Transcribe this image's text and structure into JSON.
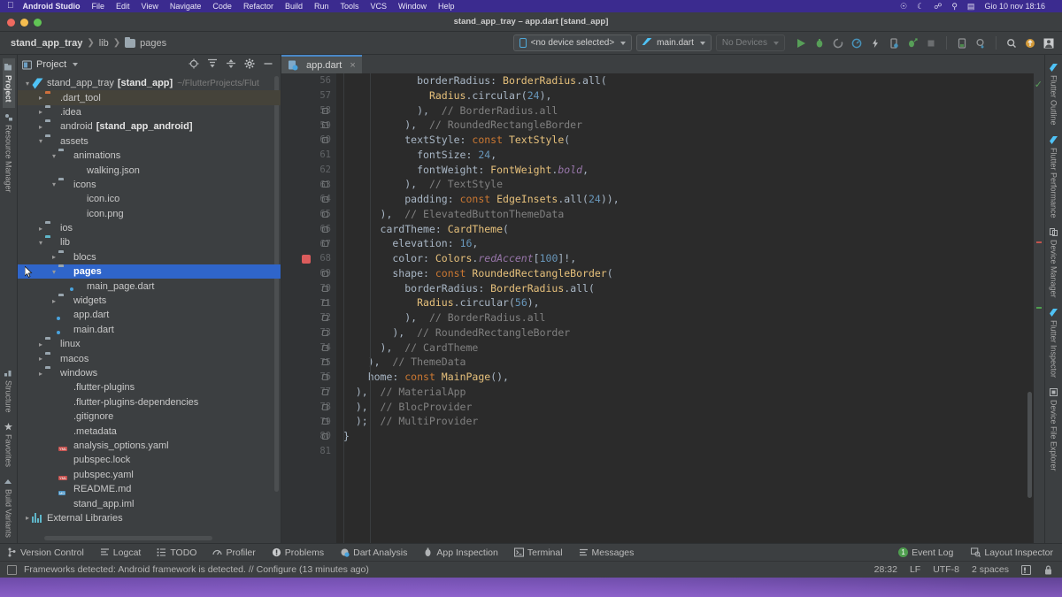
{
  "menubar": {
    "apple": "apple-logo",
    "items": [
      "Android Studio",
      "File",
      "Edit",
      "View",
      "Navigate",
      "Code",
      "Refactor",
      "Build",
      "Run",
      "Tools",
      "VCS",
      "Window",
      "Help"
    ],
    "status_icons": [
      "wifi-icon",
      "moon-icon",
      "bluetooth-icon",
      "search-icon",
      "control-center-icon"
    ],
    "clock": "Gio 10 nov 18:16"
  },
  "window": {
    "title": "stand_app_tray – app.dart [stand_app]"
  },
  "navbar": {
    "breadcrumbs": [
      "stand_app_tray",
      "lib",
      "pages"
    ],
    "device_selector": "<no device selected>",
    "run_config": "main.dart",
    "devices": "No Devices",
    "toolbar_icons": [
      "run-icon",
      "debug-icon",
      "run-with-coverage-icon",
      "profile-icon",
      "flash-hot-reload-icon",
      "device-icon",
      "attach-debugger-icon",
      "stop-icon",
      "device-manager-icon",
      "sdk-manager-icon",
      "search-everywhere-icon",
      "update-icon",
      "avatar-icon"
    ]
  },
  "left_rail": {
    "items": [
      "Project",
      "Resource Manager",
      "Structure",
      "Favorites",
      "Build Variants"
    ],
    "active": "Project"
  },
  "right_rail": {
    "items": [
      "Flutter Outline",
      "Flutter Performance",
      "Device Manager",
      "Flutter Inspector",
      "Device File Explorer"
    ]
  },
  "project_panel": {
    "title": "Project",
    "tools": [
      "locate-icon",
      "expand-all-icon",
      "collapse-all-icon",
      "settings-gear-icon",
      "minimize-icon"
    ],
    "tree": [
      {
        "label": "stand_app_tray",
        "bold_suffix": "[stand_app]",
        "path": "~/FlutterProjects/Flut",
        "indent": 0,
        "arrow": "v",
        "icon": "flutter-icon"
      },
      {
        "label": ".dart_tool",
        "indent": 1,
        "arrow": ">",
        "icon": "folder-orange-icon",
        "tint": true
      },
      {
        "label": ".idea",
        "indent": 1,
        "arrow": ">",
        "icon": "folder-idea-icon"
      },
      {
        "label": "android",
        "bold_suffix": "[stand_app_android]",
        "indent": 1,
        "arrow": ">",
        "icon": "folder-module-icon"
      },
      {
        "label": "assets",
        "indent": 1,
        "arrow": "v",
        "icon": "folder-icon"
      },
      {
        "label": "animations",
        "indent": 2,
        "arrow": "v",
        "icon": "folder-icon"
      },
      {
        "label": "walking.json",
        "indent": 3,
        "arrow": "",
        "icon": "json-file-icon"
      },
      {
        "label": "icons",
        "indent": 2,
        "arrow": "v",
        "icon": "folder-icon"
      },
      {
        "label": "icon.ico",
        "indent": 3,
        "arrow": "",
        "icon": "image-file-icon"
      },
      {
        "label": "icon.png",
        "indent": 3,
        "arrow": "",
        "icon": "image-file-icon"
      },
      {
        "label": "ios",
        "indent": 1,
        "arrow": ">",
        "icon": "folder-module-icon"
      },
      {
        "label": "lib",
        "indent": 1,
        "arrow": "v",
        "icon": "folder-source-icon"
      },
      {
        "label": "blocs",
        "indent": 2,
        "arrow": ">",
        "icon": "folder-icon"
      },
      {
        "label": "pages",
        "indent": 2,
        "arrow": "v",
        "icon": "folder-icon",
        "selected": true
      },
      {
        "label": "main_page.dart",
        "indent": 3,
        "arrow": "",
        "icon": "dart-file-icon"
      },
      {
        "label": "widgets",
        "indent": 2,
        "arrow": ">",
        "icon": "folder-icon"
      },
      {
        "label": "app.dart",
        "indent": 2,
        "arrow": "",
        "icon": "dart-file-icon"
      },
      {
        "label": "main.dart",
        "indent": 2,
        "arrow": "",
        "icon": "dart-file-icon"
      },
      {
        "label": "linux",
        "indent": 1,
        "arrow": ">",
        "icon": "folder-icon"
      },
      {
        "label": "macos",
        "indent": 1,
        "arrow": ">",
        "icon": "folder-icon"
      },
      {
        "label": "windows",
        "indent": 1,
        "arrow": ">",
        "icon": "folder-icon"
      },
      {
        "label": ".flutter-plugins",
        "indent": 2,
        "arrow": "",
        "icon": "file-icon"
      },
      {
        "label": ".flutter-plugins-dependencies",
        "indent": 2,
        "arrow": "",
        "icon": "file-icon"
      },
      {
        "label": ".gitignore",
        "indent": 2,
        "arrow": "",
        "icon": "gitignore-file-icon"
      },
      {
        "label": ".metadata",
        "indent": 2,
        "arrow": "",
        "icon": "file-icon"
      },
      {
        "label": "analysis_options.yaml",
        "indent": 2,
        "arrow": "",
        "icon": "yaml-file-icon"
      },
      {
        "label": "pubspec.lock",
        "indent": 2,
        "arrow": "",
        "icon": "file-icon"
      },
      {
        "label": "pubspec.yaml",
        "indent": 2,
        "arrow": "",
        "icon": "yaml-file-icon"
      },
      {
        "label": "README.md",
        "indent": 2,
        "arrow": "",
        "icon": "markdown-file-icon"
      },
      {
        "label": "stand_app.iml",
        "indent": 2,
        "arrow": "",
        "icon": "iml-file-icon"
      },
      {
        "label": "External Libraries",
        "indent": 0,
        "arrow": ">",
        "icon": "libraries-icon"
      }
    ]
  },
  "editor": {
    "tab": {
      "label": "app.dart",
      "close": "×",
      "icon": "dart-file-icon"
    },
    "first_line_number": 56,
    "breakpoint_line": 68,
    "lines": [
      {
        "n": 56,
        "tokens": [
          {
            "t": "            borderRadius: ",
            "c": "id"
          },
          {
            "t": "BorderRadius",
            "c": "typ"
          },
          {
            "t": ".all(",
            "c": "id"
          }
        ]
      },
      {
        "n": 57,
        "tokens": [
          {
            "t": "              ",
            "c": "id"
          },
          {
            "t": "Radius",
            "c": "typ"
          },
          {
            "t": ".circular(",
            "c": "id"
          },
          {
            "t": "24",
            "c": "num"
          },
          {
            "t": "),",
            "c": "id"
          }
        ]
      },
      {
        "n": 58,
        "tokens": [
          {
            "t": "            ),  ",
            "c": "id"
          },
          {
            "t": "// BorderRadius.all",
            "c": "cm"
          }
        ]
      },
      {
        "n": 59,
        "tokens": [
          {
            "t": "          ),  ",
            "c": "id"
          },
          {
            "t": "// RoundedRectangleBorder",
            "c": "cm"
          }
        ]
      },
      {
        "n": 60,
        "tokens": [
          {
            "t": "          textStyle: ",
            "c": "id"
          },
          {
            "t": "const ",
            "c": "kw"
          },
          {
            "t": "TextStyle",
            "c": "typ"
          },
          {
            "t": "(",
            "c": "id"
          }
        ]
      },
      {
        "n": 61,
        "tokens": [
          {
            "t": "            fontSize: ",
            "c": "id"
          },
          {
            "t": "24",
            "c": "num"
          },
          {
            "t": ",",
            "c": "id"
          }
        ]
      },
      {
        "n": 62,
        "tokens": [
          {
            "t": "            fontWeight: ",
            "c": "id"
          },
          {
            "t": "FontWeight",
            "c": "typ"
          },
          {
            "t": ".",
            "c": "id"
          },
          {
            "t": "bold",
            "c": "fld"
          },
          {
            "t": ",",
            "c": "id"
          }
        ]
      },
      {
        "n": 63,
        "tokens": [
          {
            "t": "          ),  ",
            "c": "id"
          },
          {
            "t": "// TextStyle",
            "c": "cm"
          }
        ]
      },
      {
        "n": 64,
        "tokens": [
          {
            "t": "          padding: ",
            "c": "id"
          },
          {
            "t": "const ",
            "c": "kw"
          },
          {
            "t": "EdgeInsets",
            "c": "typ"
          },
          {
            "t": ".all(",
            "c": "id"
          },
          {
            "t": "24",
            "c": "num"
          },
          {
            "t": ")),",
            "c": "id"
          }
        ]
      },
      {
        "n": 65,
        "tokens": [
          {
            "t": "      ),  ",
            "c": "id"
          },
          {
            "t": "// ElevatedButtonThemeData",
            "c": "cm"
          }
        ]
      },
      {
        "n": 66,
        "tokens": [
          {
            "t": "      cardTheme: ",
            "c": "id"
          },
          {
            "t": "CardTheme",
            "c": "typ"
          },
          {
            "t": "(",
            "c": "id"
          }
        ]
      },
      {
        "n": 67,
        "tokens": [
          {
            "t": "        elevation: ",
            "c": "id"
          },
          {
            "t": "16",
            "c": "num"
          },
          {
            "t": ",",
            "c": "id"
          }
        ]
      },
      {
        "n": 68,
        "tokens": [
          {
            "t": "        color: ",
            "c": "id"
          },
          {
            "t": "Colors",
            "c": "typ"
          },
          {
            "t": ".",
            "c": "id"
          },
          {
            "t": "redAccent",
            "c": "fld"
          },
          {
            "t": "[",
            "c": "id"
          },
          {
            "t": "100",
            "c": "num"
          },
          {
            "t": "]!,",
            "c": "id"
          }
        ]
      },
      {
        "n": 69,
        "tokens": [
          {
            "t": "        shape: ",
            "c": "id"
          },
          {
            "t": "const ",
            "c": "kw"
          },
          {
            "t": "RoundedRectangleBorder",
            "c": "typ"
          },
          {
            "t": "(",
            "c": "id"
          }
        ]
      },
      {
        "n": 70,
        "tokens": [
          {
            "t": "          borderRadius: ",
            "c": "id"
          },
          {
            "t": "BorderRadius",
            "c": "typ"
          },
          {
            "t": ".all(",
            "c": "id"
          }
        ]
      },
      {
        "n": 71,
        "tokens": [
          {
            "t": "            ",
            "c": "id"
          },
          {
            "t": "Radius",
            "c": "typ"
          },
          {
            "t": ".circular(",
            "c": "id"
          },
          {
            "t": "56",
            "c": "num"
          },
          {
            "t": "),",
            "c": "id"
          }
        ]
      },
      {
        "n": 72,
        "tokens": [
          {
            "t": "          ),  ",
            "c": "id"
          },
          {
            "t": "// BorderRadius.all",
            "c": "cm"
          }
        ]
      },
      {
        "n": 73,
        "tokens": [
          {
            "t": "        ),  ",
            "c": "id"
          },
          {
            "t": "// RoundedRectangleBorder",
            "c": "cm"
          }
        ]
      },
      {
        "n": 74,
        "tokens": [
          {
            "t": "      ),  ",
            "c": "id"
          },
          {
            "t": "// CardTheme",
            "c": "cm"
          }
        ]
      },
      {
        "n": 75,
        "tokens": [
          {
            "t": "    ),  ",
            "c": "id"
          },
          {
            "t": "// ThemeData",
            "c": "cm"
          }
        ]
      },
      {
        "n": 76,
        "tokens": [
          {
            "t": "    home: ",
            "c": "id"
          },
          {
            "t": "const ",
            "c": "kw"
          },
          {
            "t": "MainPage",
            "c": "typ"
          },
          {
            "t": "(),",
            "c": "id"
          }
        ]
      },
      {
        "n": 77,
        "tokens": [
          {
            "t": "  ),  ",
            "c": "id"
          },
          {
            "t": "// MaterialApp",
            "c": "cm"
          }
        ]
      },
      {
        "n": 78,
        "tokens": [
          {
            "t": "  ),  ",
            "c": "id"
          },
          {
            "t": "// BlocProvider",
            "c": "cm"
          }
        ]
      },
      {
        "n": 79,
        "tokens": [
          {
            "t": "  );  ",
            "c": "id"
          },
          {
            "t": "// MultiProvider",
            "c": "cm"
          }
        ]
      },
      {
        "n": 80,
        "tokens": [
          {
            "t": "}",
            "c": "id"
          }
        ]
      },
      {
        "n": 81,
        "tokens": [
          {
            "t": "",
            "c": "id"
          }
        ]
      }
    ]
  },
  "bottom_bar": {
    "left_items": [
      {
        "label": "Version Control",
        "icon": "branch-icon"
      },
      {
        "label": "Logcat",
        "icon": "logcat-icon"
      },
      {
        "label": "TODO",
        "icon": "todo-icon"
      },
      {
        "label": "Profiler",
        "icon": "profiler-icon"
      },
      {
        "label": "Problems",
        "icon": "problems-icon"
      },
      {
        "label": "Dart Analysis",
        "icon": "dart-analysis-icon"
      },
      {
        "label": "App Inspection",
        "icon": "app-inspection-icon"
      },
      {
        "label": "Terminal",
        "icon": "terminal-icon"
      },
      {
        "label": "Messages",
        "icon": "messages-icon"
      }
    ],
    "right_items": [
      {
        "label": "Event Log",
        "badge": "1",
        "icon": "event-log-icon"
      },
      {
        "label": "Layout Inspector",
        "icon": "layout-inspector-icon"
      }
    ]
  },
  "status_bar": {
    "message": "Frameworks detected: Android framework is detected. // Configure (13 minutes ago)",
    "caret": "28:32",
    "line_separator": "LF",
    "encoding": "UTF-8",
    "indent": "2 spaces",
    "icons": [
      "notifications-icon",
      "lock-icon"
    ]
  },
  "colors": {
    "accent_blue": "#2f65ca",
    "run_green": "#4f9e4f",
    "breakpoint_red": "#db5c5c",
    "menubar_purple": "#3b2b8f"
  }
}
